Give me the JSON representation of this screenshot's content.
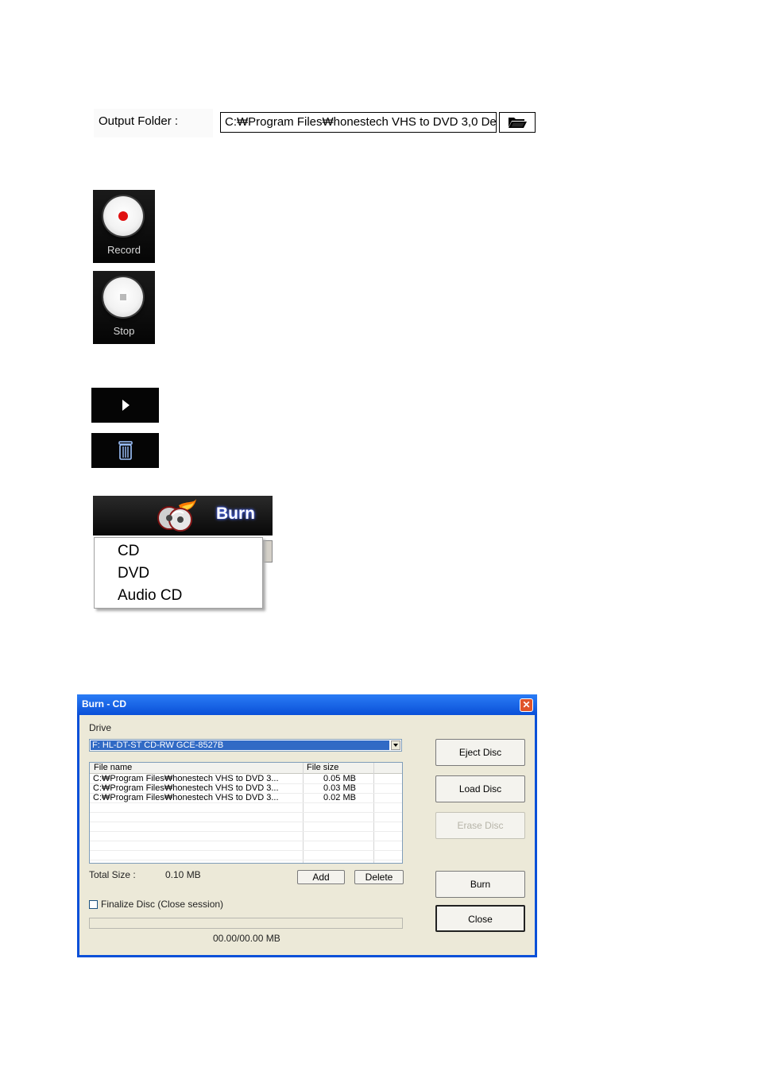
{
  "output_folder": {
    "label": "Output Folder :",
    "path": "C:₩Program Files₩honestech VHS to DVD 3,0 De",
    "browse_icon": "folder-open-icon"
  },
  "record_button": {
    "label": "Record",
    "icon": "record-icon",
    "accent": "#e01010"
  },
  "stop_button": {
    "label": "Stop",
    "icon": "stop-icon"
  },
  "play_button": {
    "icon": "play-icon"
  },
  "delete_button": {
    "icon": "trash-icon"
  },
  "burn_menu": {
    "label": "Burn",
    "icon": "burn-discs-icon",
    "items": [
      {
        "label": "CD"
      },
      {
        "label": "DVD"
      },
      {
        "label": "Audio CD"
      }
    ]
  },
  "burn_dialog": {
    "title": "Burn - CD",
    "drive_label": "Drive",
    "drive_value": "F: HL-DT-ST CD-RW GCE-8527B",
    "columns": [
      "File name",
      "File size"
    ],
    "files": [
      {
        "name": "C:₩Program Files₩honestech VHS to DVD 3...",
        "size": "0.05 MB"
      },
      {
        "name": "C:₩Program Files₩honestech VHS to DVD 3...",
        "size": "0.03 MB"
      },
      {
        "name": "C:₩Program Files₩honestech VHS to DVD 3...",
        "size": "0.02 MB"
      }
    ],
    "total_size_label": "Total Size :",
    "total_size_value": "0.10 MB",
    "add_label": "Add",
    "delete_label": "Delete",
    "finalize_label": "Finalize Disc  (Close session)",
    "finalize_checked": false,
    "progress_fraction": 0,
    "progress_text": "00.00/00.00 MB",
    "eject_label": "Eject Disc",
    "load_label": "Load Disc",
    "erase_label": "Erase Disc",
    "burn_label": "Burn",
    "close_label": "Close",
    "title_color": "#0a50d8"
  }
}
